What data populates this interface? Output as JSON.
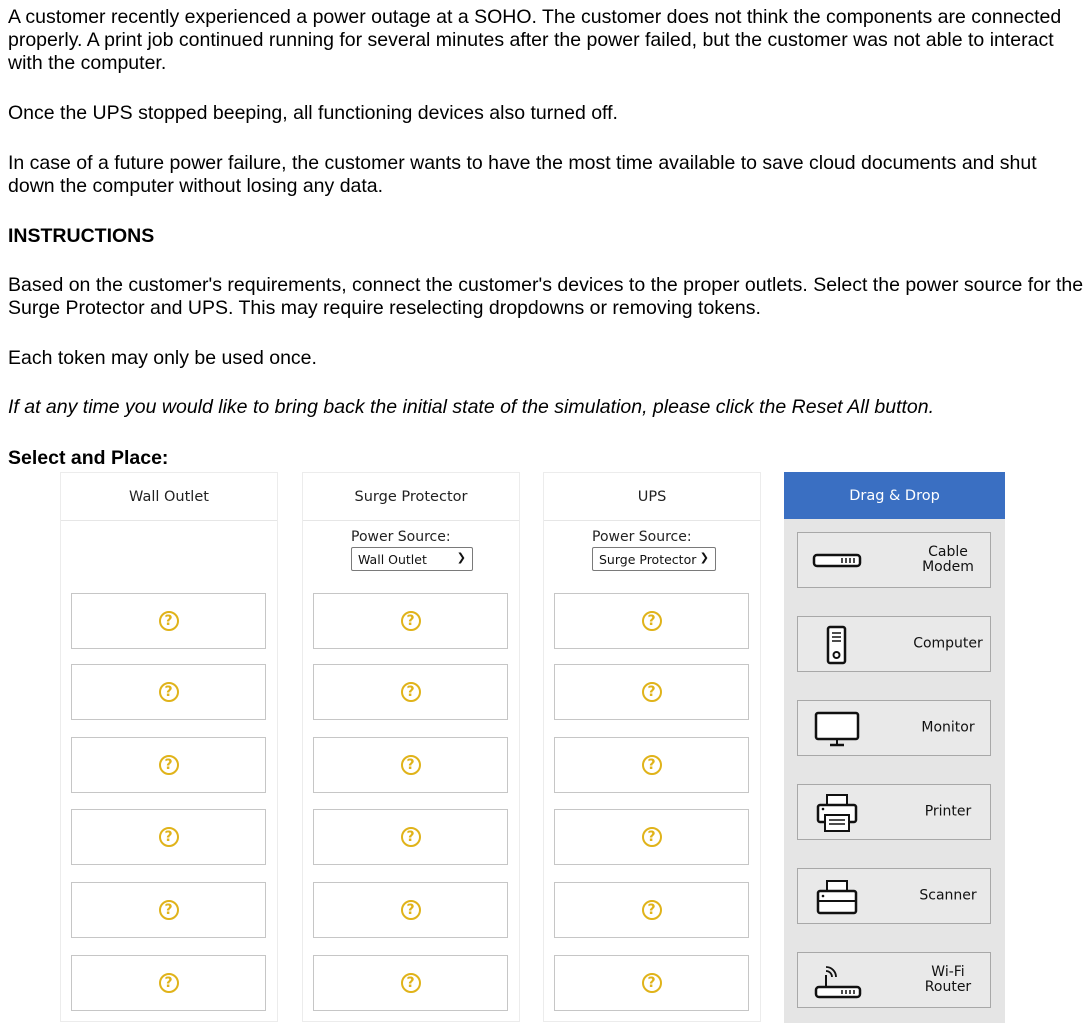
{
  "intro": {
    "p1": "A customer recently experienced a power outage at a SOHO. The customer does not think the components are connected properly. A print job continued running for several minutes after the power failed, but the customer was not able to interact with the computer.",
    "p2": "Once the UPS stopped beeping, all functioning devices also turned off.",
    "p3": "In case of a future power failure, the customer wants to have the most time available to save cloud documents and shut down the computer without losing any data.",
    "instructions_heading": "INSTRUCTIONS",
    "p4": "Based on the customer's requirements, connect the customer's devices to the proper outlets. Select the power source for the Surge Protector and UPS. This may require reselecting dropdowns or removing tokens.",
    "p5": "Each token may only be used once.",
    "p6": "If at any time you would like to bring back the initial state of the simulation, please click the Reset All button.",
    "select_heading": "Select and Place:"
  },
  "columns": [
    {
      "title": "Wall Outlet"
    },
    {
      "title": "Surge Protector",
      "power_source_label": "Power Source:",
      "power_source_value": "Wall Outlet"
    },
    {
      "title": "UPS",
      "power_source_label": "Power Source:",
      "power_source_value": "Surge Protector"
    }
  ],
  "slot_placeholder": "?",
  "dragdrop": {
    "title": "Drag & Drop",
    "tokens": [
      {
        "label": "Cable Modem",
        "icon": "cable-modem-icon"
      },
      {
        "label": "Computer",
        "icon": "computer-tower-icon"
      },
      {
        "label": "Monitor",
        "icon": "monitor-icon"
      },
      {
        "label": "Printer",
        "icon": "printer-icon"
      },
      {
        "label": "Scanner",
        "icon": "scanner-icon"
      },
      {
        "label": "Wi-Fi Router",
        "icon": "wifi-router-icon"
      }
    ]
  },
  "colors": {
    "accent": "#3a6fc2",
    "placeholder": "#e0b31a",
    "panel": "#e5e5e5"
  }
}
